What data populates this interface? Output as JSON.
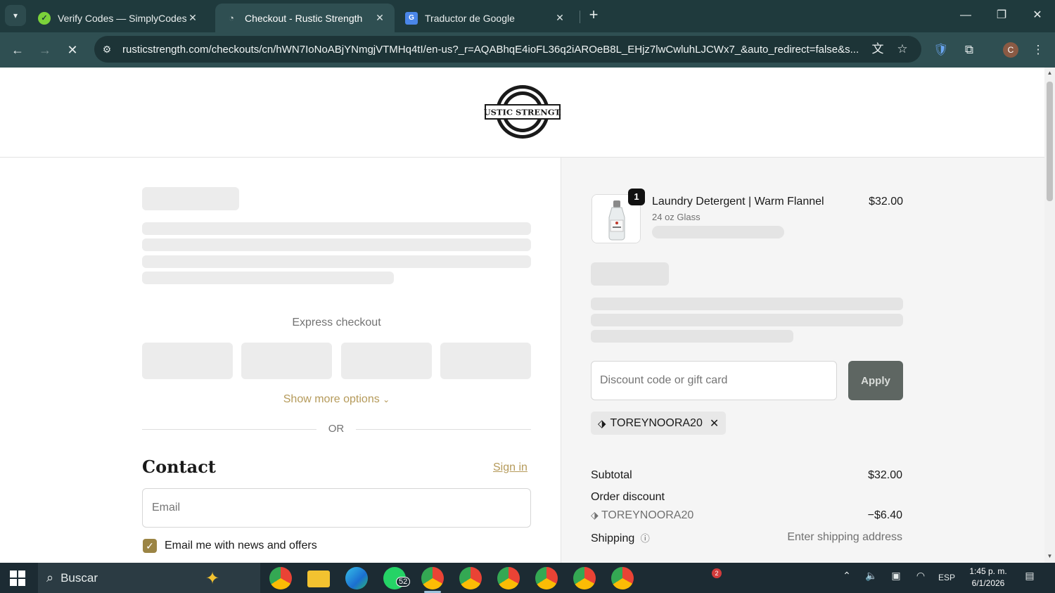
{
  "browser": {
    "tabs": [
      {
        "title": "Verify Codes — SimplyCodes",
        "favicon": "simplycodes-icon",
        "active": false
      },
      {
        "title": "Checkout - Rustic Strength",
        "favicon": "loading-icon",
        "active": true
      },
      {
        "title": "Traductor de Google",
        "favicon": "google-translate-icon",
        "active": false
      }
    ],
    "url": "rusticstrength.com/checkouts/cn/hWN7IoNoABjYNmgjVTMHq4tI/en-us?_r=AQABhqE4ioFL36q2iAROeB8L_EHjz7lwCwluhLJCWx7_&auto_redirect=false&s...",
    "profile_initial": "C"
  },
  "store": {
    "logo_text": "RUSTIC STRENGTH"
  },
  "checkout": {
    "express_title": "Express checkout",
    "show_more": "Show more options",
    "or_text": "OR",
    "contact_heading": "Contact",
    "sign_in": "Sign in",
    "email_placeholder": "Email",
    "news_label": "Email me with news and offers",
    "news_checked": true
  },
  "summary": {
    "item": {
      "quantity": "1",
      "name": "Laundry Detergent | Warm Flannel",
      "variant": "24 oz Glass",
      "price": "$32.00"
    },
    "discount_placeholder": "Discount code or gift card",
    "apply_label": "Apply",
    "applied_code": "TOREYNOORA20",
    "subtotal_label": "Subtotal",
    "subtotal_value": "$32.00",
    "order_discount_label": "Order discount",
    "discount_code": "TOREYNOORA20",
    "discount_value": "−$6.40",
    "shipping_label": "Shipping",
    "shipping_value": "Enter shipping address"
  },
  "taskbar": {
    "search_text": "Buscar",
    "whatsapp_badge": "52",
    "notification_badge": "2",
    "language": "ESP",
    "time": "1:45 p. m.",
    "date": "6/1/2026"
  },
  "colors": {
    "accent_gold": "#b59a5a",
    "checkbox": "#9b8444",
    "apply_button": "#5e6662",
    "chrome_dark": "#1f3a3d"
  }
}
